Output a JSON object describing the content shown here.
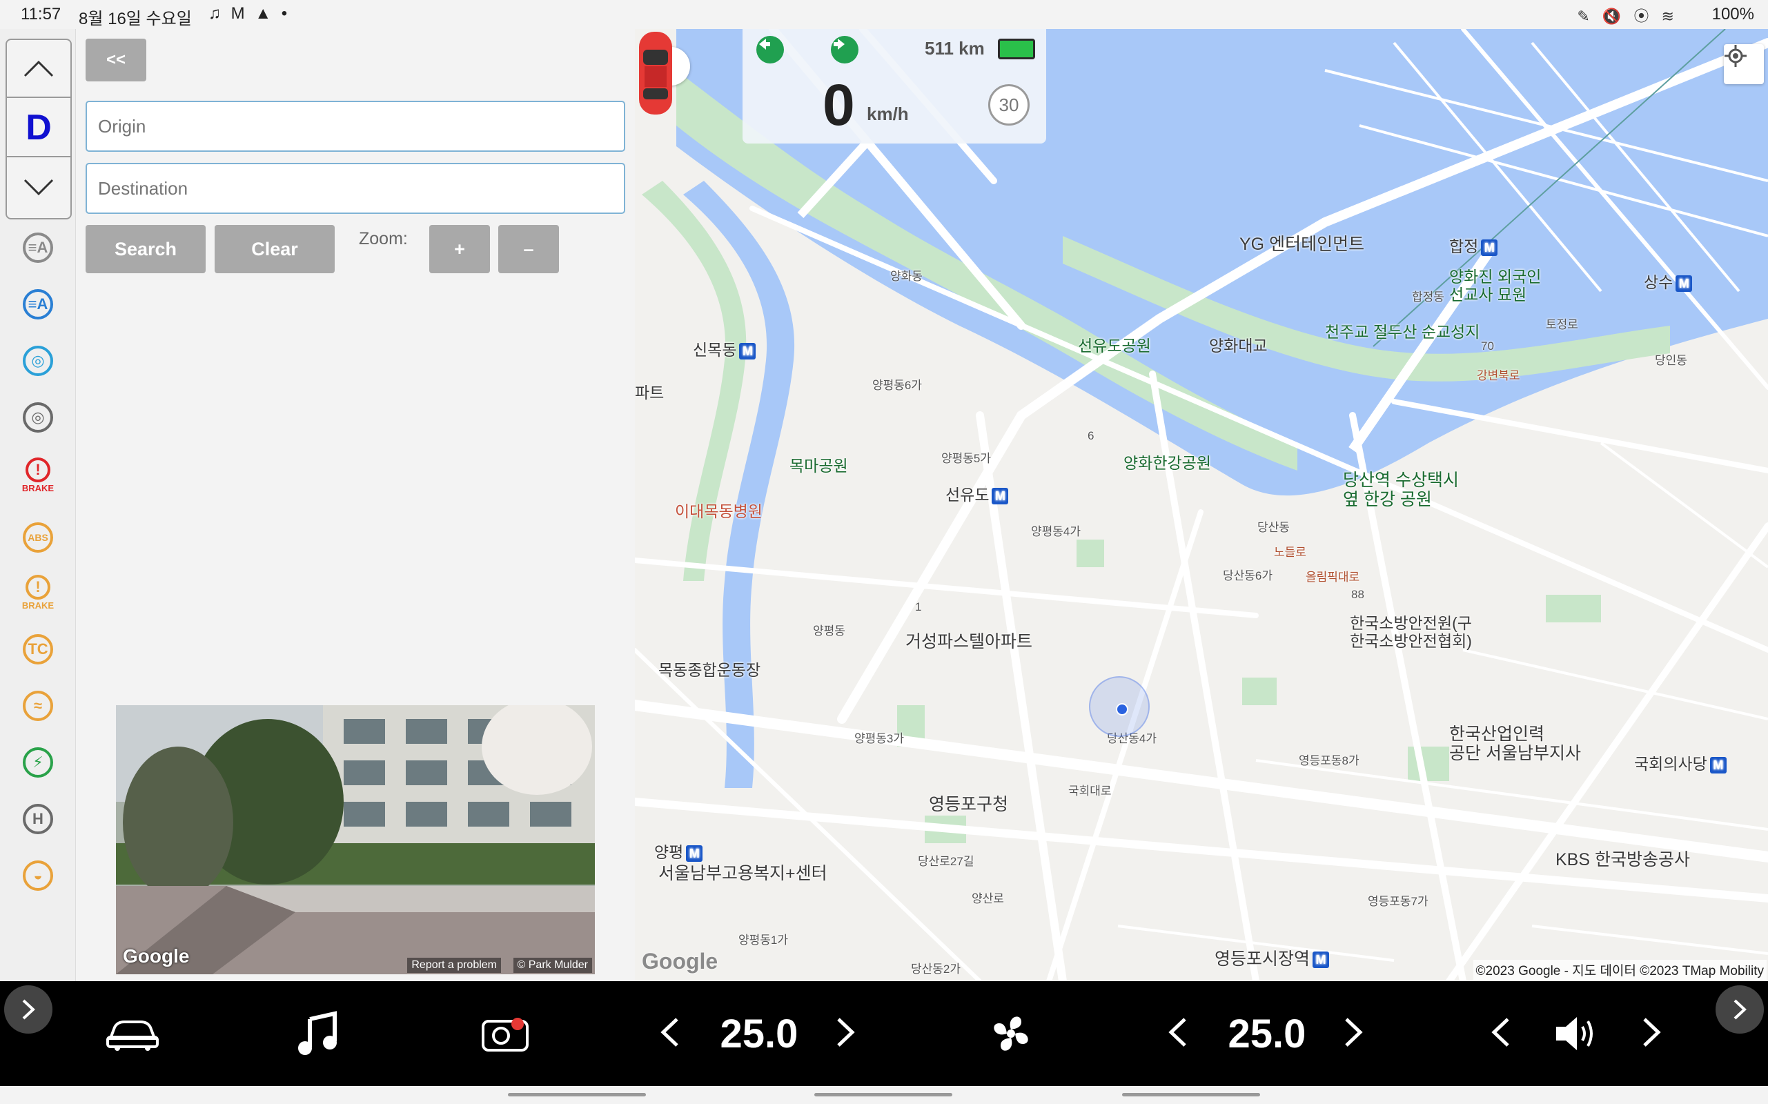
{
  "status_bar": {
    "time": "11:57",
    "date": "8월 16일 수요일",
    "notifications": "♫ M ▲ •",
    "right_icons": "✎ 🔇 ⦿ ≋",
    "battery": "100%"
  },
  "gear": {
    "current": "D"
  },
  "telltales": [
    {
      "name": "low-beam-icon",
      "color": "#8a8a8a",
      "symbol": "≡A"
    },
    {
      "name": "auto-high-beam-icon",
      "color": "#2a7fd4",
      "symbol": "≡A"
    },
    {
      "name": "steering-assist-icon",
      "color": "#2aa0d8",
      "symbol": "◎"
    },
    {
      "name": "steering-wheel-icon",
      "color": "#6a6a6a",
      "symbol": "◎"
    },
    {
      "name": "brake-warning-icon",
      "color": "#e0262a",
      "symbol": "!",
      "label": "BRAKE"
    },
    {
      "name": "abs-icon",
      "color": "#e9a23a",
      "symbol": "ABS"
    },
    {
      "name": "brake-fault-icon",
      "color": "#e9a23a",
      "symbol": "!",
      "label": "BRAKE"
    },
    {
      "name": "traction-control-icon",
      "color": "#e9a23a",
      "symbol": "TC"
    },
    {
      "name": "stability-control-icon",
      "color": "#e9a23a",
      "symbol": "≈"
    },
    {
      "name": "ev-charge-icon",
      "color": "#2aa24a",
      "symbol": "⚡"
    },
    {
      "name": "hold-icon",
      "color": "#6a6a6a",
      "symbol": "H"
    },
    {
      "name": "collision-warning-icon",
      "color": "#e9a23a",
      "symbol": "◒"
    }
  ],
  "panel": {
    "collapse_label": "<<",
    "origin_placeholder": "Origin",
    "destination_placeholder": "Destination",
    "search_label": "Search",
    "clear_label": "Clear",
    "zoom_label": "Zoom:",
    "zoom_in_label": "+",
    "zoom_out_label": "–",
    "streetview": {
      "brand": "Google",
      "report": "Report a problem",
      "copyright": "© Park Mulder"
    }
  },
  "cluster": {
    "range": "511 km",
    "speed": "0",
    "speed_unit": "km/h",
    "speed_limit": "30"
  },
  "map": {
    "labels": {
      "yg": "YG 엔터테인먼트",
      "hapjeong": "합정",
      "yanghwajin": "양화진 외국인\n선교사 묘원",
      "hapjeongdong": "합정동",
      "sangsu": "상수",
      "tojeongro": "토정로",
      "dangindong": "당인동",
      "sinmokdong": "신목동",
      "yanghwadong": "양화동",
      "seonyudo_park": "선유도공원",
      "yanghwa_bridge": "양화대교",
      "jeoldusan": "천주교 절두산 순교성지",
      "gangbyeonbukro": "강변북로",
      "route70": "70",
      "apt": "파트",
      "yangpyeong6": "양평동6가",
      "yangpyeong5": "양평동5가",
      "yangpyeong4": "양평동4가",
      "yangpyeong3": "양평동3가",
      "yangpyeong1": "양평동1가",
      "yangpyeongdong": "양평동",
      "mokma_park": "목마공원",
      "seonyudo": "선유도",
      "yanghwa_hangang": "양화한강공원",
      "dangsan_taxi": "당산역 수상택시\n옆 한강 공원",
      "ewha_hospital": "이대목동병원",
      "dangsandong": "당산동",
      "dangsan6": "당산동6가",
      "dangsan4": "당산동4가",
      "dangsan2": "당산동2가",
      "noduldo": "노들로",
      "olympic": "올림픽대로",
      "route88": "88",
      "route6": "6",
      "route1": "1",
      "fire_institute": "한국소방안전원(구\n한국소방안전협회)",
      "geoseong": "거성파스텔아파트",
      "mokdong_stadium": "목동종합운동장",
      "yeongdeungpo8": "영등포동8가",
      "kpc": "한국산업인력\n공단 서울남부지사",
      "assembly": "국회의사당",
      "yeongdeungpo_office": "영등포구청",
      "gukhoedaero": "국회대로",
      "yangpyeong_station": "양평",
      "seoul_south_welfare": "서울남부고용복지+센터",
      "dangsanro27": "당산로27길",
      "yangsanro": "양산로",
      "kbs": "KBS 한국방송공사",
      "yeongdeungpo7": "영등포동7가",
      "market_station": "영등포시장역"
    },
    "brand": "Google",
    "attribution": "©2023 Google - 지도 데이터 ©2023 TMap Mobility"
  },
  "dock": {
    "driver_temp": "25.0",
    "passenger_temp": "25.0"
  },
  "colors": {
    "water": "#a8c8f8",
    "park": "#c8e6c9",
    "dock_bg": "#000000",
    "button_gray": "#a9a9a9",
    "gear_blue": "#1010d0"
  }
}
